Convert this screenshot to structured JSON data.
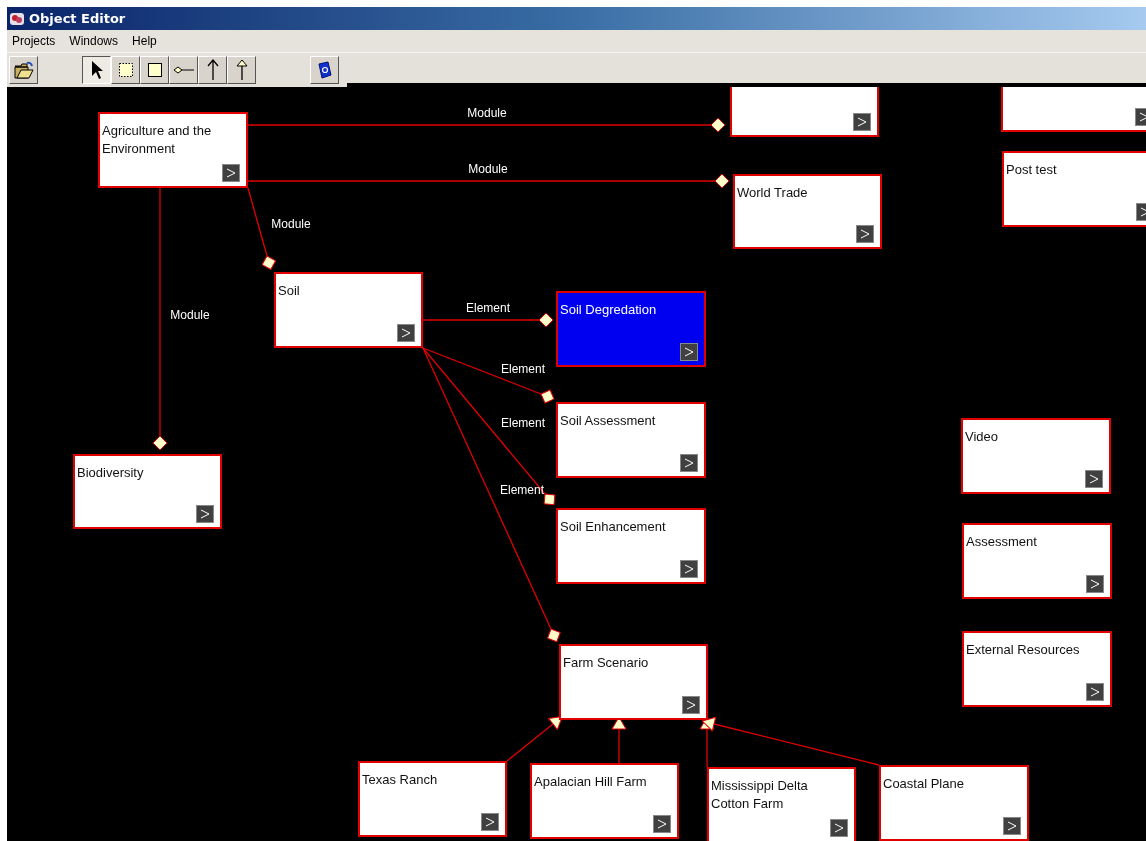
{
  "window": {
    "title": "Object Editor"
  },
  "menu": [
    "Projects",
    "Windows",
    "Help"
  ],
  "tools": [
    {
      "kind": "pointer",
      "selected": true
    },
    {
      "kind": "marquee",
      "selected": false
    },
    {
      "kind": "node",
      "selected": false
    },
    {
      "kind": "aggregation",
      "selected": false
    },
    {
      "kind": "arrow",
      "selected": false
    },
    {
      "kind": "inheritance",
      "selected": false
    }
  ],
  "nodes": [
    {
      "label": "Agriculture and the Environment",
      "selected": false
    },
    {
      "selected": false
    },
    {
      "selected": false
    },
    {
      "label": "Post test",
      "selected": false
    },
    {
      "label": "World Trade",
      "selected": false
    },
    {
      "label": "Soil",
      "selected": false
    },
    {
      "label": "Soil Degredation",
      "selected": true
    },
    {
      "label": "Soil Assessment",
      "selected": false
    },
    {
      "label": "Biodiversity",
      "selected": false
    },
    {
      "label": "Soil Enhancement",
      "selected": false
    },
    {
      "label": "Video",
      "selected": false
    },
    {
      "label": "Assessment",
      "selected": false
    },
    {
      "label": "External Resources",
      "selected": false
    },
    {
      "label": "Farm Scenario",
      "selected": false
    },
    {
      "label": "Texas Ranch",
      "selected": false
    },
    {
      "label": "Apalacian Hill Farm",
      "selected": false
    },
    {
      "label": "Mississippi Delta Cotton Farm",
      "selected": false
    },
    {
      "label": "Coastal Plane",
      "selected": false
    }
  ],
  "edges": [
    {
      "kind": "aggregation",
      "label": "Module"
    },
    {
      "kind": "aggregation",
      "label": "Module"
    },
    {
      "kind": "aggregation",
      "label": "Module"
    },
    {
      "kind": "aggregation",
      "label": "Module"
    },
    {
      "kind": "aggregation",
      "label": "Element"
    },
    {
      "kind": "aggregation",
      "label": "Element"
    },
    {
      "kind": "aggregation",
      "label": "Element"
    },
    {
      "kind": "aggregation",
      "label": "Element"
    },
    {
      "kind": "inheritance"
    },
    {
      "kind": "inheritance"
    },
    {
      "kind": "inheritance"
    },
    {
      "kind": "inheritance"
    }
  ]
}
